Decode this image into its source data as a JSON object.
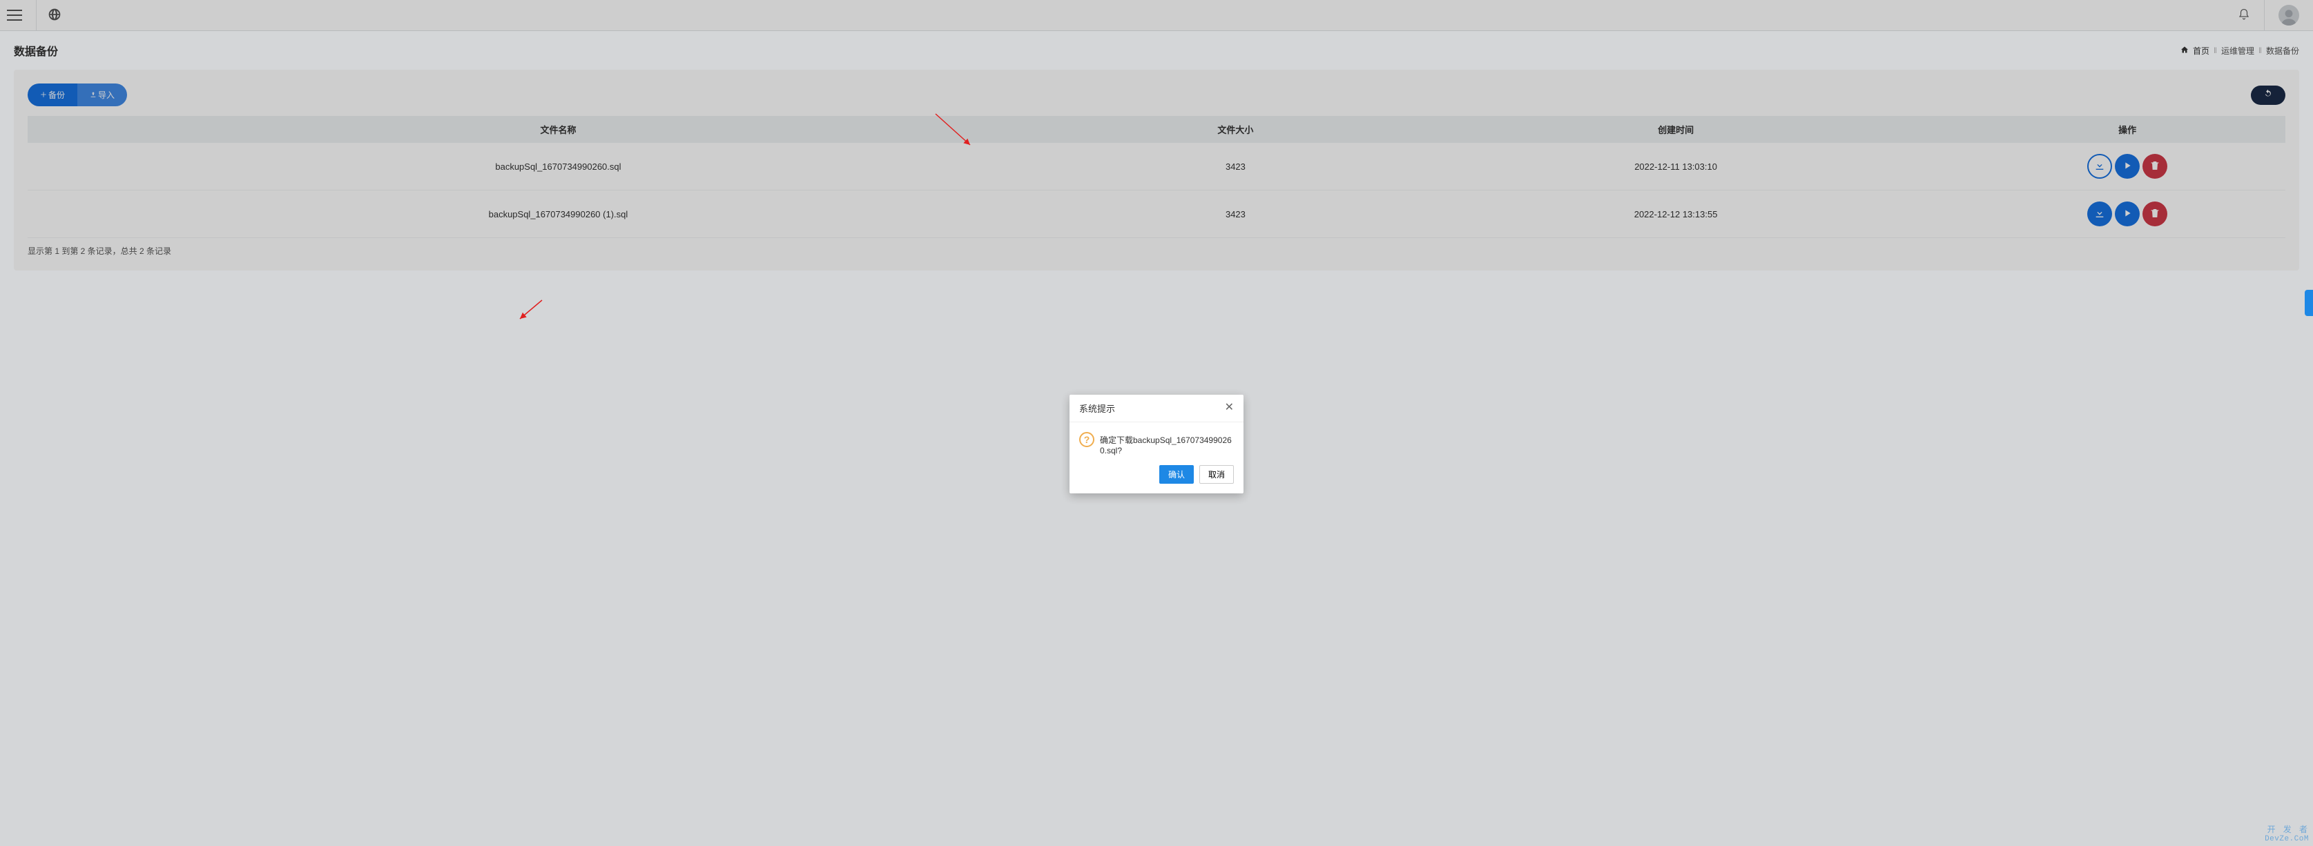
{
  "navbar": {
    "menu_hint": "menu",
    "globe_hint": "language"
  },
  "page": {
    "title": "数据备份"
  },
  "breadcrumb": {
    "home": "首页",
    "mid": "运维管理",
    "current": "数据备份"
  },
  "toolbar": {
    "backup_label": "备份",
    "import_label": "导入"
  },
  "table": {
    "columns": {
      "name": "文件名称",
      "size": "文件大小",
      "created": "创建时间",
      "action": "操作"
    },
    "rows": [
      {
        "name": "backupSql_1670734990260.sql",
        "size": "3423",
        "created": "2022-12-11 13:03:10",
        "highlight_download": true
      },
      {
        "name": "backupSql_1670734990260 (1).sql",
        "size": "3423",
        "created": "2022-12-12 13:13:55",
        "highlight_download": false
      }
    ],
    "footer": "显示第 1 到第 2 条记录，总共 2 条记录"
  },
  "modal": {
    "title": "系统提示",
    "message": "确定下载backupSql_1670734990260.sql?",
    "confirm": "确认",
    "cancel": "取消"
  },
  "watermark": {
    "line1": "开 发 者",
    "line2": "DevZe.CoM"
  }
}
